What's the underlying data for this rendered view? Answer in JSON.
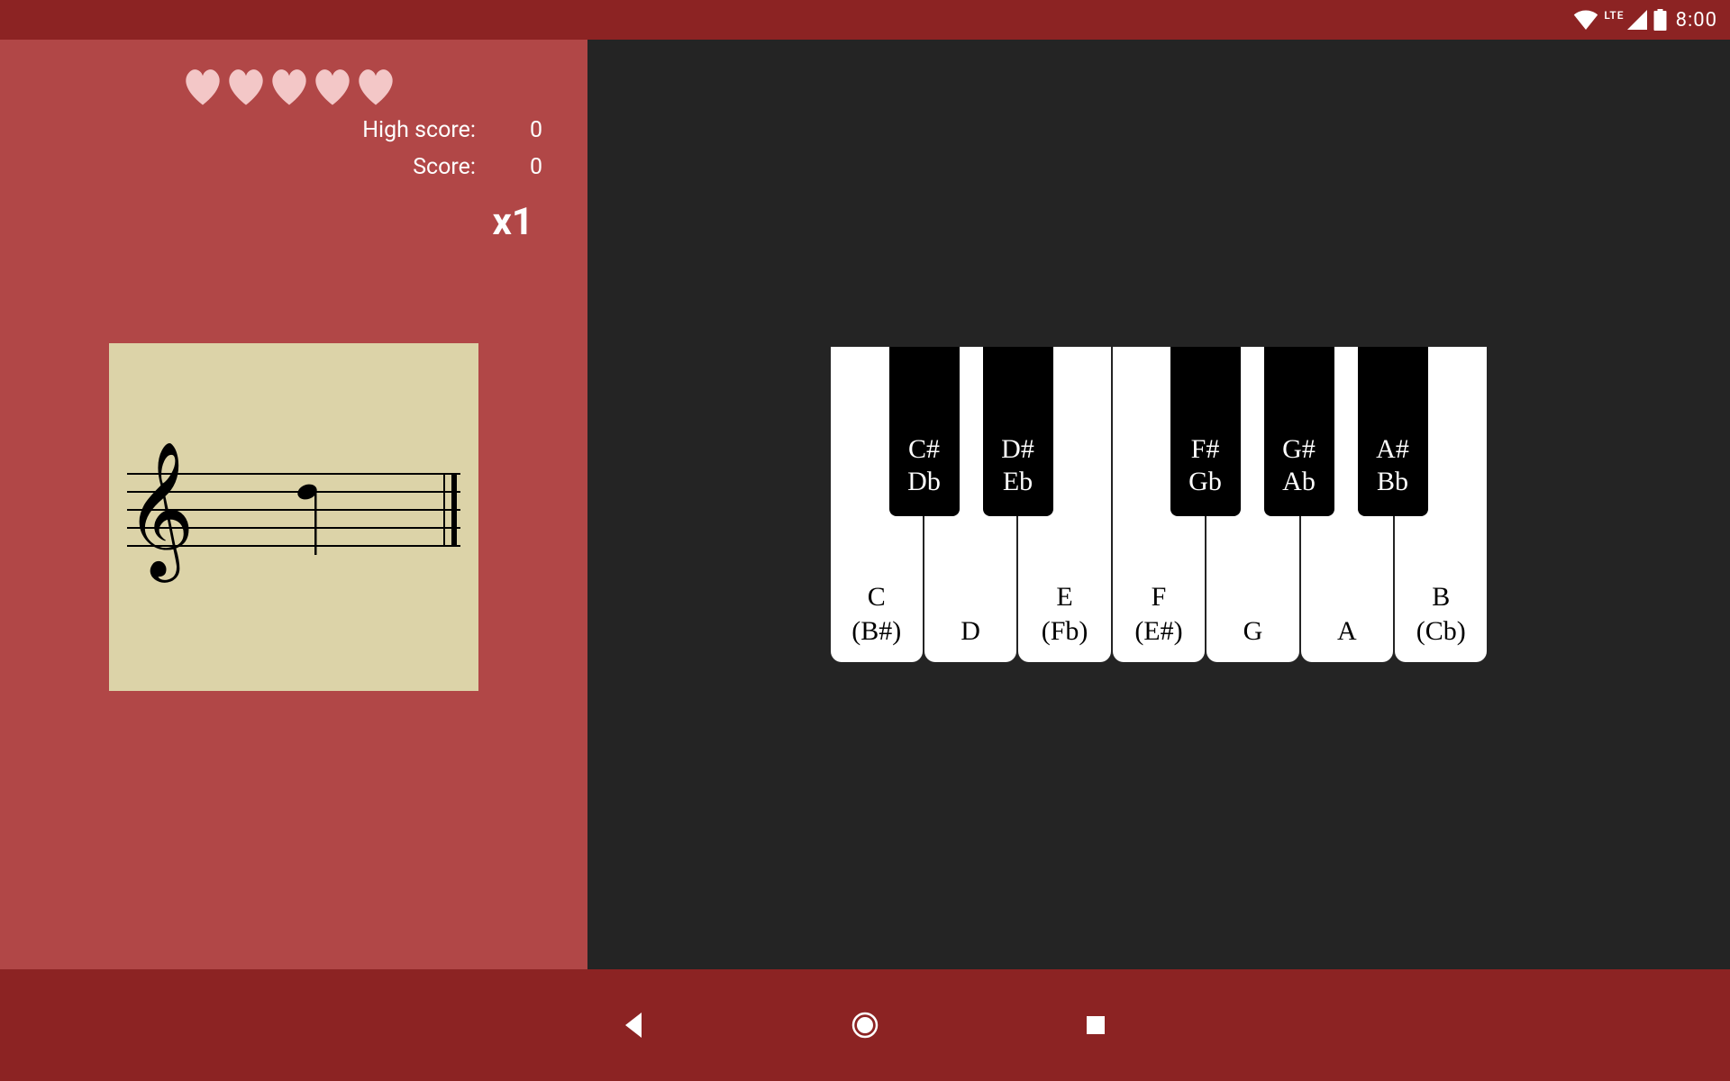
{
  "status": {
    "time": "8:00",
    "lte": "LTE"
  },
  "game": {
    "hearts": 5,
    "highscore_label": "High score:",
    "highscore_value": "0",
    "score_label": "Score:",
    "score_value": "0",
    "multiplier": "x1"
  },
  "keys": {
    "white": [
      {
        "main": "C",
        "alt": "(B#)"
      },
      {
        "main": "D",
        "alt": ""
      },
      {
        "main": "E",
        "alt": "(Fb)"
      },
      {
        "main": "F",
        "alt": "(E#)"
      },
      {
        "main": "G",
        "alt": ""
      },
      {
        "main": "A",
        "alt": ""
      },
      {
        "main": "B",
        "alt": "(Cb)"
      }
    ],
    "black": [
      {
        "sharp": "C#",
        "flat": "Db",
        "pos": 65
      },
      {
        "sharp": "D#",
        "flat": "Eb",
        "pos": 169
      },
      {
        "sharp": "F#",
        "flat": "Gb",
        "pos": 377
      },
      {
        "sharp": "G#",
        "flat": "Ab",
        "pos": 481
      },
      {
        "sharp": "A#",
        "flat": "Bb",
        "pos": 585
      }
    ]
  },
  "colors": {
    "accent": "#8c2323",
    "panel": "#b14747",
    "card": "#dcd3a8",
    "dark": "#242424",
    "heart": "#f3c7c7"
  }
}
